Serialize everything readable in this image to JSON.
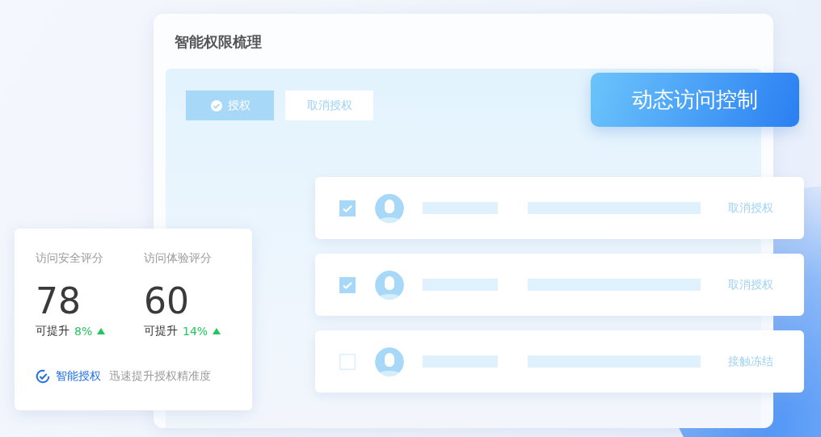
{
  "panel": {
    "title": "智能权限梳理",
    "buttons": [
      {
        "label": "授权",
        "selected": true
      },
      {
        "label": "取消授权",
        "selected": false
      }
    ]
  },
  "badge": {
    "label": "动态访问控制"
  },
  "rows": [
    {
      "checked": true,
      "action": "取消授权"
    },
    {
      "checked": true,
      "action": "取消授权"
    },
    {
      "checked": false,
      "action": "接触冻结"
    }
  ],
  "scores": {
    "items": [
      {
        "label": "访问安全评分",
        "value": "78",
        "improve_label": "可提升",
        "improve": "8%"
      },
      {
        "label": "访问体验评分",
        "value": "60",
        "improve_label": "可提升",
        "improve": "14%"
      }
    ],
    "footer": {
      "title": "智能授权",
      "text": "迅速提升授权精准度"
    }
  }
}
